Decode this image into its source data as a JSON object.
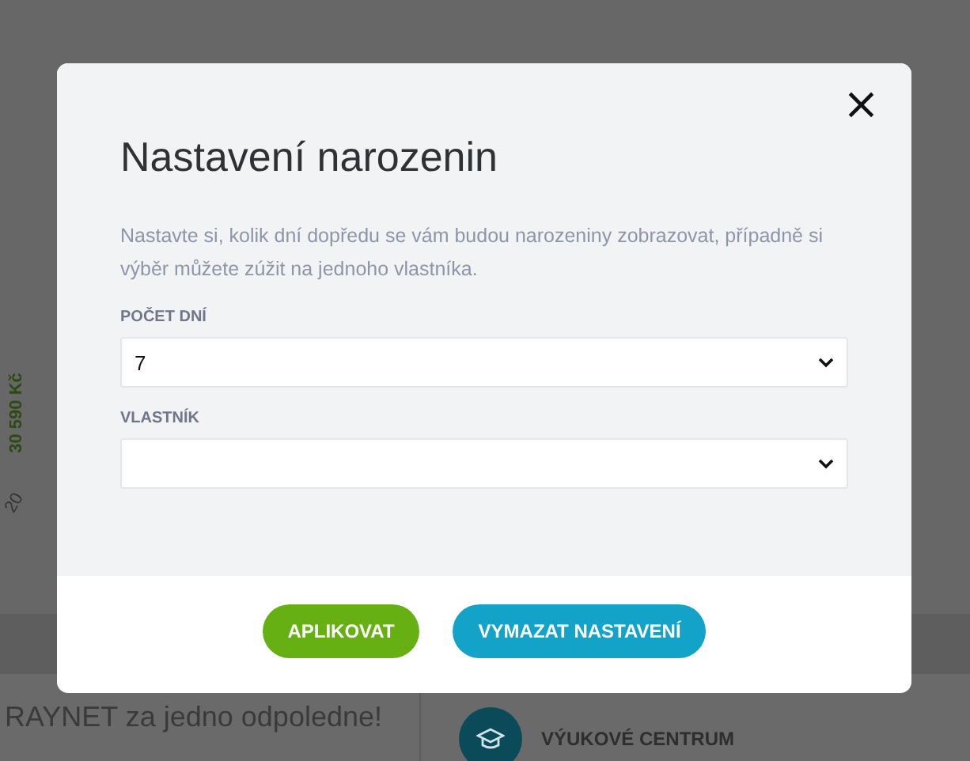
{
  "background": {
    "amount": "30 590 Kč",
    "date_fragment": "20",
    "promo_text": "RAYNET za jedno odpoledne!",
    "learning_link": "VÝUKOVÉ CENTRUM"
  },
  "dialog": {
    "title": "Nastavení narozenin",
    "close": "×",
    "description": "Nastavte si, kolik dní dopředu se vám budou narozeniny zobrazovat, případně si výběr můžete zúžit na jednoho vlastníka.",
    "fields": [
      {
        "label": "POČET DNÍ",
        "value": "7"
      },
      {
        "label": "VLASTNÍK"
      }
    ],
    "buttons": [
      {
        "label": "APLIKOVAT",
        "kind": "primary"
      },
      {
        "label": "VYMAZAT NASTAVENÍ",
        "kind": "secondary"
      }
    ]
  }
}
